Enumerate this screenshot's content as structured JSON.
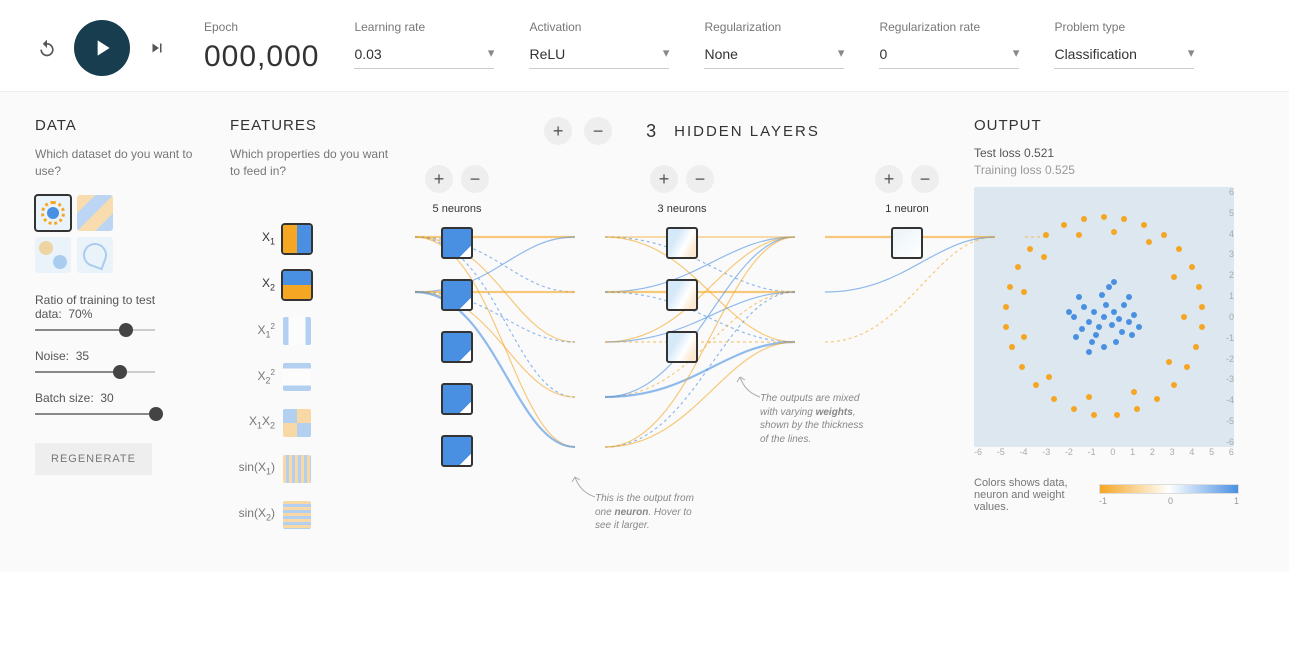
{
  "controls": {
    "epoch_label": "Epoch",
    "epoch_value": "000,000",
    "learning_rate_label": "Learning rate",
    "learning_rate_value": "0.03",
    "activation_label": "Activation",
    "activation_value": "ReLU",
    "regularization_label": "Regularization",
    "regularization_value": "None",
    "reg_rate_label": "Regularization rate",
    "reg_rate_value": "0",
    "problem_label": "Problem type",
    "problem_value": "Classification"
  },
  "data_panel": {
    "title": "DATA",
    "desc": "Which dataset do you want to use?",
    "ratio_label": "Ratio of training to test data:",
    "ratio_value": "70%",
    "noise_label": "Noise:",
    "noise_value": "35",
    "batch_label": "Batch size:",
    "batch_value": "30",
    "regenerate": "REGENERATE"
  },
  "features_panel": {
    "title": "FEATURES",
    "desc": "Which properties do you want to feed in?",
    "items": [
      {
        "label": "X₁",
        "active": true
      },
      {
        "label": "X₂",
        "active": true
      },
      {
        "label": "X₁²",
        "active": false
      },
      {
        "label": "X₂²",
        "active": false
      },
      {
        "label": "X₁X₂",
        "active": false
      },
      {
        "label": "sin(X₁)",
        "active": false
      },
      {
        "label": "sin(X₂)",
        "active": false
      }
    ]
  },
  "network": {
    "hidden_layers_count": "3",
    "hidden_layers_label": "HIDDEN LAYERS",
    "layers": [
      {
        "count": "5 neurons"
      },
      {
        "count": "3 neurons"
      },
      {
        "count": "1 neuron"
      }
    ],
    "callout1": "This is the output from one neuron. Hover to see it larger.",
    "callout2": "The outputs are mixed with varying weights, shown by the thickness of the lines."
  },
  "output": {
    "title": "OUTPUT",
    "test_loss_label": "Test loss",
    "test_loss_value": "0.521",
    "train_loss_label": "Training loss",
    "train_loss_value": "0.525",
    "legend_text": "Colors shows data, neuron and weight values.",
    "legend_min": "-1",
    "legend_mid": "0",
    "legend_max": "1",
    "axis_ticks": [
      "-6",
      "-5",
      "-4",
      "-3",
      "-2",
      "-1",
      "0",
      "1",
      "2",
      "3",
      "4",
      "5",
      "6"
    ]
  },
  "callout_kw_neuron": "neuron",
  "callout_kw_weights": "weights"
}
